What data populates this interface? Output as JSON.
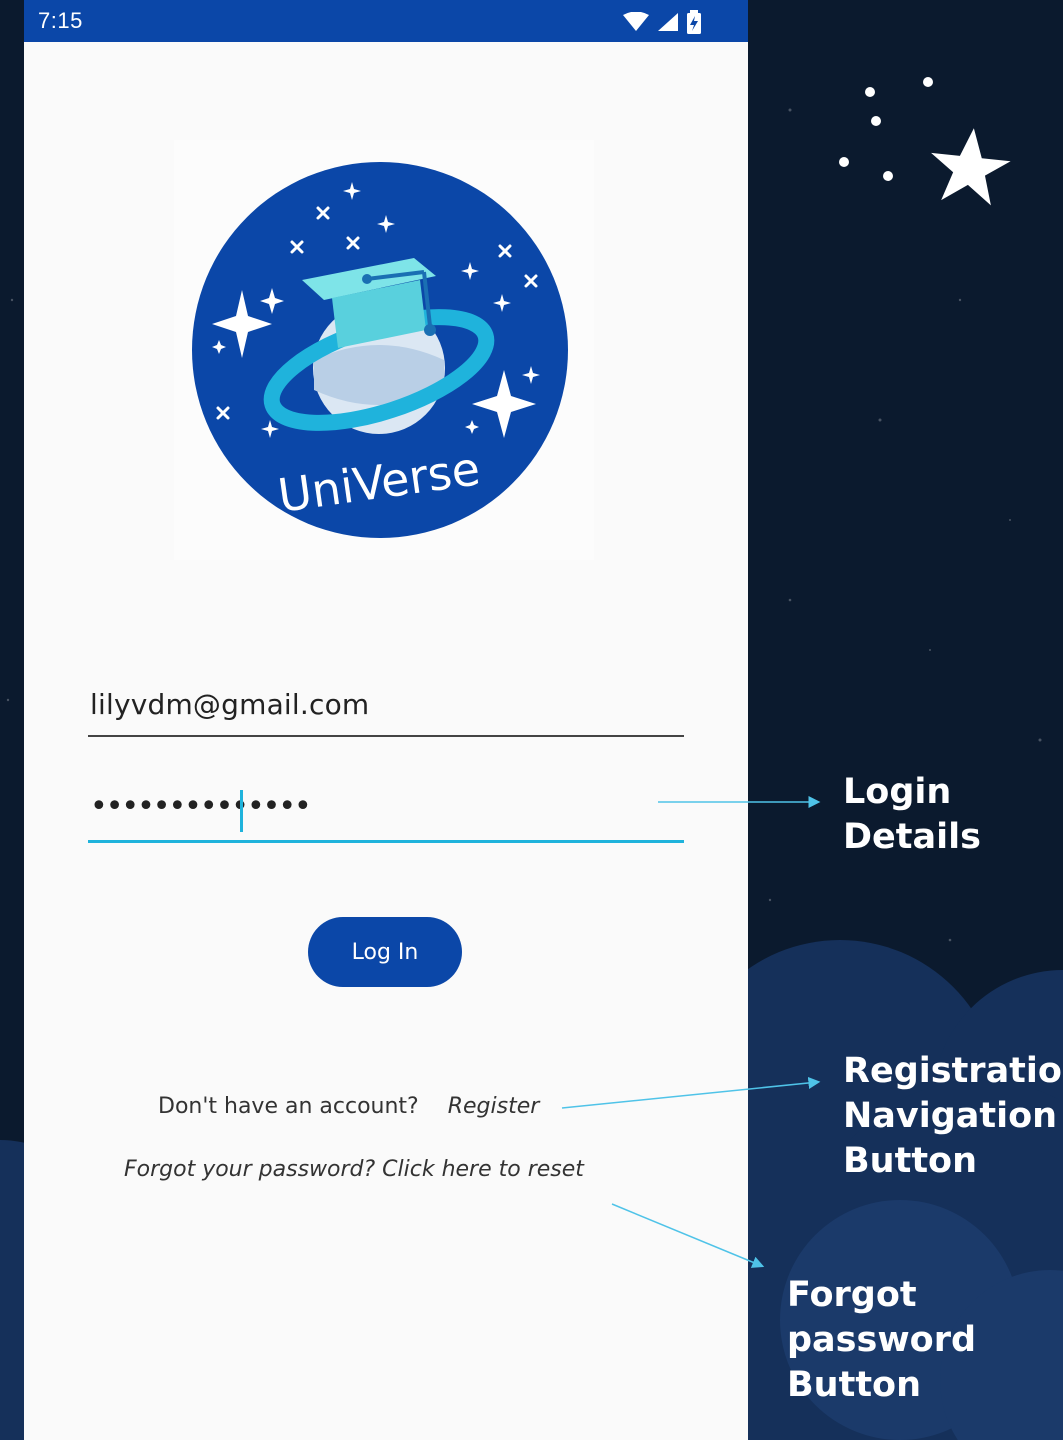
{
  "status_bar": {
    "time": "7:15",
    "icons": [
      "wifi-icon",
      "signal-icon",
      "battery-charging-icon"
    ]
  },
  "logo": {
    "brand_text": "UniVerse",
    "description_icon": "graduation-cap-planet-logo"
  },
  "form": {
    "email_value": "lilyvdm@gmail.com",
    "password_mask": "••••••••••••••",
    "login_label": "Log In"
  },
  "links": {
    "no_account_text": "Don't have an account?",
    "register_label": "Register",
    "forgot_label": "Forgot your password? Click here to reset"
  },
  "annotations": {
    "login_details": [
      "Login",
      "Details"
    ],
    "registration": [
      "Registration",
      "Navigation",
      "Button"
    ],
    "forgot": [
      "Forgot",
      "password",
      "Button"
    ]
  },
  "colors": {
    "primary_blue": "#0b47a8",
    "accent_cyan": "#1fb3dc",
    "night_sky": "#0b1a2e",
    "cloud_blue": "#17335e"
  }
}
